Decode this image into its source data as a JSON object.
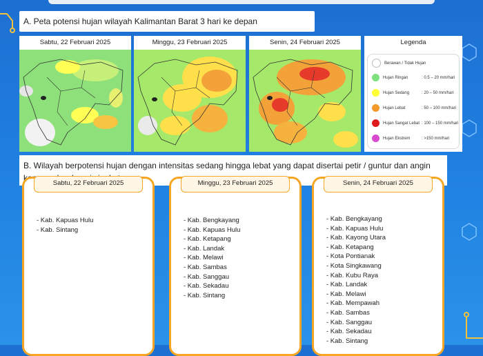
{
  "section_a": {
    "title": "A. Peta potensi hujan wilayah Kalimantan Barat 3 hari ke depan"
  },
  "maps": [
    {
      "date": "Sabtu, 22 Februari 2025"
    },
    {
      "date": "Minggu, 23 Februari 2025"
    },
    {
      "date": "Senin, 24 Februari 2025"
    }
  ],
  "legend": {
    "title": "Legenda",
    "items": [
      {
        "name": "Berawan / Tidak Hujan",
        "range": "",
        "color": "#ffffff"
      },
      {
        "name": "Hujan Ringan",
        "range": ": 0.5 – 20 mm/hari",
        "color": "#7fe07f"
      },
      {
        "name": "Hujan Sedang",
        "range": ": 20 – 50 mm/hari",
        "color": "#ffff33"
      },
      {
        "name": "Hujan Lebat",
        "range": ": 50 – 100 mm/hari",
        "color": "#f39a2b"
      },
      {
        "name": "Hujan Sangat Lebat",
        "range": ": 100 – 150 mm/hari",
        "color": "#e01b1b"
      },
      {
        "name": "Hujan Ekstrem",
        "range": ": >150 mm/hari",
        "color": "#d94ad0"
      }
    ]
  },
  "section_b": {
    "title": "B. Wilayah berpotensi hujan dengan intensitas sedang hingga lebat yang dapat disertai petir / guntur dan angin kencang berdurasi singkat :"
  },
  "cards": [
    {
      "date": "Sabtu, 22 Februari 2025",
      "items": [
        "- Kab. Kapuas Hulu",
        "- Kab. Sintang"
      ]
    },
    {
      "date": "Minggu, 23 Februari 2025",
      "items": [
        "- Kab. Bengkayang",
        "- Kab. Kapuas Hulu",
        "- Kab. Ketapang",
        "- Kab. Landak",
        "- Kab. Melawi",
        "- Kab. Sambas",
        "- Kab. Sanggau",
        "- Kab. Sekadau",
        "- Kab. Sintang"
      ]
    },
    {
      "date": "Senin, 24 Februari 2025",
      "items": [
        "- Kab. Bengkayang",
        "- Kab. Kapuas Hulu",
        "- Kab. Kayong Utara",
        "- Kab. Ketapang",
        "- Kota Pontianak",
        "- Kota Singkawang",
        "- Kab. Kubu Raya",
        "- Kab. Landak",
        "- Kab. Melawi",
        "- Kab. Mempawah",
        "- Kab. Sambas",
        "- Kab. Sanggau",
        "- Kab. Sekadau",
        "- Kab. Sintang"
      ]
    }
  ]
}
